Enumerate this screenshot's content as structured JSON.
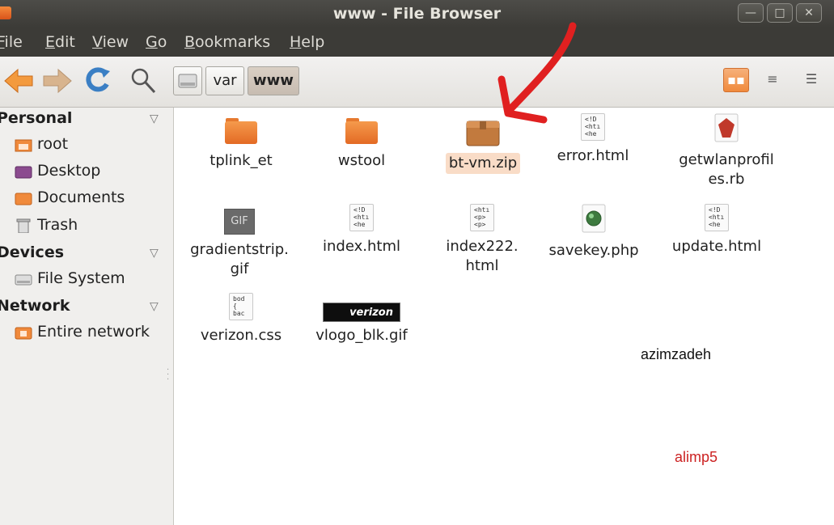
{
  "window": {
    "title": "www - File Browser",
    "minimize": "—",
    "maximize": "□",
    "close": "✕"
  },
  "menu": [
    {
      "label": "File",
      "accel": "F",
      "rest": "ile"
    },
    {
      "label": "Edit",
      "accel": "E",
      "rest": "dit"
    },
    {
      "label": "View",
      "accel": "V",
      "rest": "iew"
    },
    {
      "label": "Go",
      "accel": "G",
      "rest": "o"
    },
    {
      "label": "Bookmarks",
      "accel": "B",
      "rest": "ookmarks"
    },
    {
      "label": "Help",
      "accel": "H",
      "rest": "elp"
    }
  ],
  "toolbar": {
    "back_icon": "back-arrow-icon",
    "forward_icon": "forward-arrow-icon",
    "reload_icon": "reload-icon",
    "search_icon": "search-icon",
    "path": [
      "var",
      "www"
    ],
    "views": [
      "icon-view",
      "list-view",
      "compact-view"
    ]
  },
  "sidebar": {
    "sections": [
      {
        "title": "Personal",
        "items": [
          "root",
          "Desktop",
          "Documents",
          "Trash"
        ]
      },
      {
        "title": "Devices",
        "items": [
          "File System"
        ]
      },
      {
        "title": "Network",
        "items": [
          "Entire network"
        ]
      }
    ]
  },
  "files": [
    {
      "name": "tplink_et",
      "type": "folder"
    },
    {
      "name": "wstool",
      "type": "folder"
    },
    {
      "name": "bt-vm.zip",
      "type": "archive",
      "selected": true
    },
    {
      "name": "error.html",
      "type": "html"
    },
    {
      "name": "getwlanprofil",
      "name2": "es.rb",
      "type": "ruby"
    },
    {
      "name": "gradientstrip.",
      "name2": "gif",
      "type": "gif",
      "thumb": "GIF"
    },
    {
      "name": "index.html",
      "type": "html"
    },
    {
      "name": "index222.",
      "name2": "html",
      "type": "html"
    },
    {
      "name": "savekey.php",
      "type": "php"
    },
    {
      "name": "update.html",
      "type": "html"
    },
    {
      "name": "verizon.css",
      "type": "css"
    },
    {
      "name": "vlogo_blk.gif",
      "type": "gif-logo",
      "thumb": "verizon"
    }
  ],
  "annotations": [
    {
      "text": "azimzadeh",
      "color": "#111111"
    },
    {
      "text": "alimp5",
      "color": "#cc2222"
    }
  ],
  "colors": {
    "accent": "#f08a3c",
    "arrow": "#e02020",
    "titlebar": "#3c3b37"
  }
}
